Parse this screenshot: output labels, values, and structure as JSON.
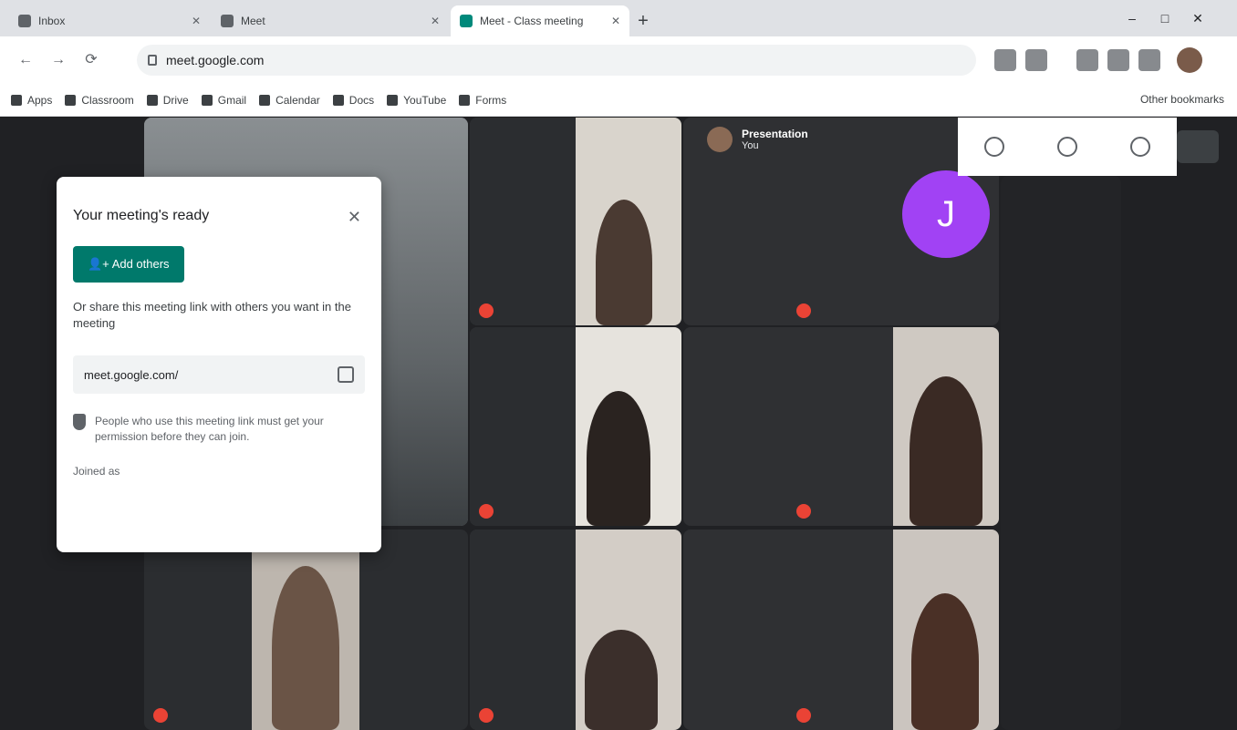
{
  "browser": {
    "tabs": [
      {
        "label": "Inbox"
      },
      {
        "label": "Meet"
      },
      {
        "label": "Meet - Class meeting"
      }
    ],
    "newtab_label": "+",
    "window_controls": [
      "–",
      "□",
      "✕"
    ],
    "nav": {
      "back": "←",
      "forward": "→",
      "reload": "⟳"
    },
    "url": "meet.google.com"
  },
  "bookmarks": {
    "items": [
      "Apps",
      "Classroom",
      "Drive",
      "Gmail",
      "Calendar",
      "Docs",
      "YouTube",
      "Forms"
    ],
    "other": "Other bookmarks"
  },
  "meet": {
    "presenter": {
      "name": "Presentation",
      "sub": "You"
    },
    "tiles": [
      {
        "name": ""
      },
      {
        "name": ""
      },
      {
        "name": ""
      },
      {
        "name": ""
      },
      {
        "name": ""
      },
      {
        "name": ""
      },
      {
        "name": ""
      },
      {
        "name": ""
      },
      {
        "name": ""
      }
    ],
    "avatar_letter": "J",
    "colors": {
      "avatar": "#a142f4",
      "join_button": "#00796b",
      "background": "#202124"
    }
  },
  "popup": {
    "title": "Your meeting's ready",
    "close": "✕",
    "join_label": "Add others",
    "description": "Or share this meeting link with others you want in the meeting",
    "link": "meet.google.com/",
    "security": "People who use this meeting link must get your permission before they can join.",
    "joined": "Joined as"
  }
}
